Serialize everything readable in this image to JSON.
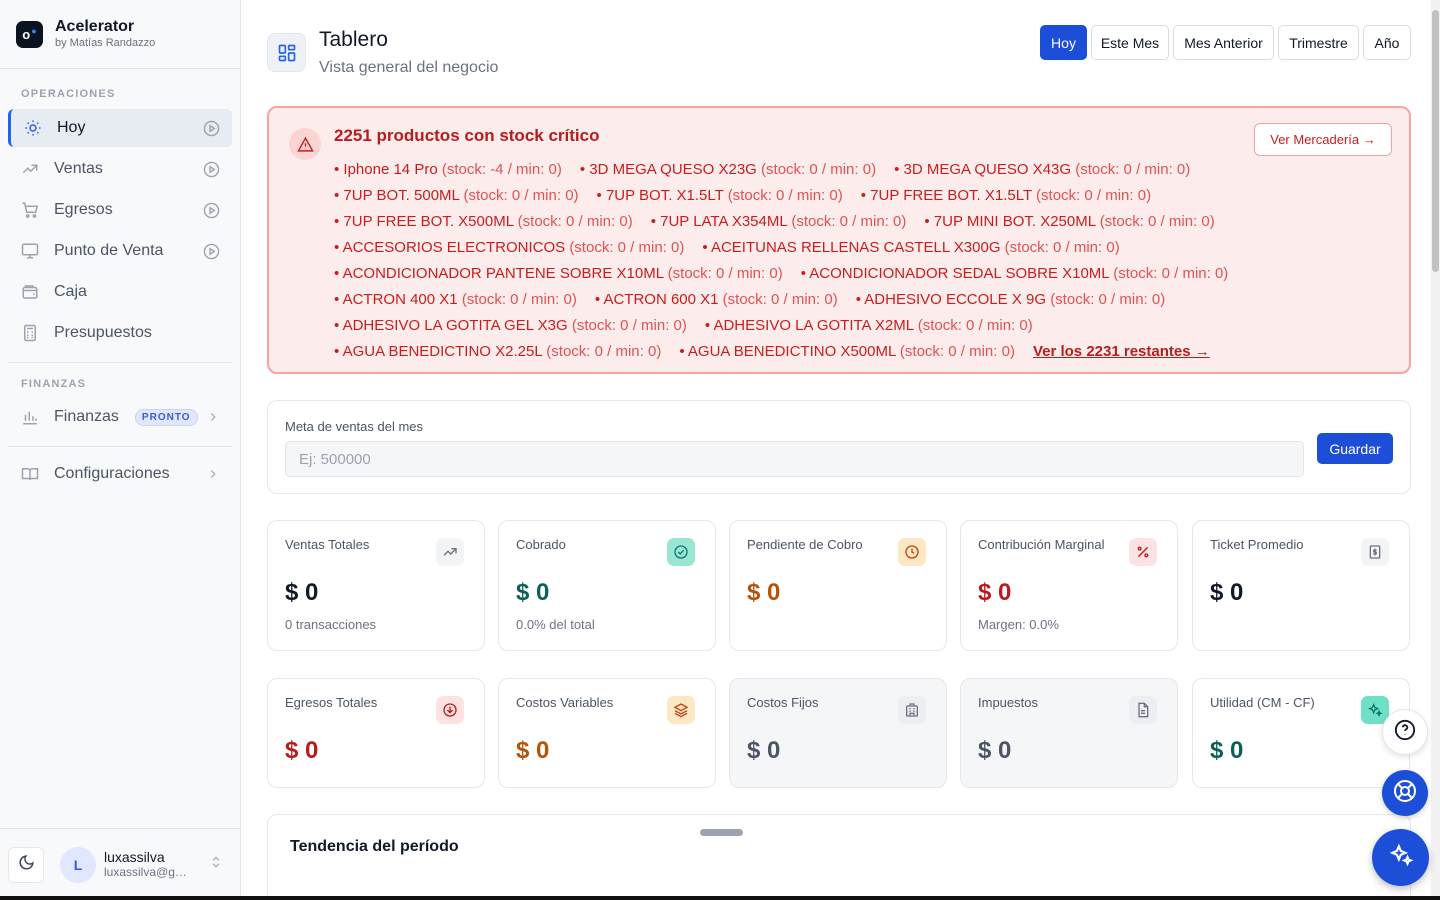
{
  "brand": {
    "name": "Acelerator",
    "sub": "by Matías Randazzo"
  },
  "sidebar": {
    "section_ops": "OPERACIONES",
    "section_fin": "FINANZAS",
    "items": [
      {
        "label": "Hoy"
      },
      {
        "label": "Ventas"
      },
      {
        "label": "Egresos"
      },
      {
        "label": "Punto de Venta"
      },
      {
        "label": "Caja"
      },
      {
        "label": "Presupuestos"
      }
    ],
    "finanzas": {
      "label": "Finanzas",
      "badge": "PRONTO"
    },
    "config": {
      "label": "Configuraciones"
    },
    "user": {
      "initial": "L",
      "name": "luxassilva",
      "email": "luxassilva@gm..."
    }
  },
  "header": {
    "title": "Tablero",
    "subtitle": "Vista general del negocio"
  },
  "periods": [
    "Hoy",
    "Este Mes",
    "Mes Anterior",
    "Trimestre",
    "Año"
  ],
  "alert": {
    "title": "2251 productos con stock crítico",
    "button": "Ver Mercadería →",
    "more": "Ver los 2231 restantes →",
    "lines": [
      [
        {
          "name": "Iphone 14 Pro",
          "info": "(stock: -4 / min: 0)"
        },
        {
          "name": "3D MEGA QUESO X23G",
          "info": "(stock: 0 / min: 0)"
        },
        {
          "name": "3D MEGA QUESO X43G",
          "info": "(stock: 0 / min: 0)"
        }
      ],
      [
        {
          "name": "7UP BOT. 500ML",
          "info": "(stock: 0 / min: 0)"
        },
        {
          "name": "7UP BOT. X1.5LT",
          "info": "(stock: 0 / min: 0)"
        },
        {
          "name": "7UP FREE BOT. X1.5LT",
          "info": "(stock: 0 / min: 0)"
        }
      ],
      [
        {
          "name": "7UP FREE BOT. X500ML",
          "info": "(stock: 0 / min: 0)"
        },
        {
          "name": "7UP LATA X354ML",
          "info": "(stock: 0 / min: 0)"
        },
        {
          "name": "7UP MINI BOT. X250ML",
          "info": "(stock: 0 / min: 0)"
        }
      ],
      [
        {
          "name": "ACCESORIOS ELECTRONICOS",
          "info": "(stock: 0 / min: 0)"
        },
        {
          "name": "ACEITUNAS RELLENAS CASTELL X300G",
          "info": "(stock: 0 / min: 0)"
        }
      ],
      [
        {
          "name": "ACONDICIONADOR PANTENE SOBRE X10ML",
          "info": "(stock: 0 / min: 0)"
        },
        {
          "name": "ACONDICIONADOR SEDAL SOBRE X10ML",
          "info": "(stock: 0 / min: 0)"
        }
      ],
      [
        {
          "name": "ACTRON 400 X1",
          "info": "(stock: 0 / min: 0)"
        },
        {
          "name": "ACTRON 600 X1",
          "info": "(stock: 0 / min: 0)"
        },
        {
          "name": "ADHESIVO ECCOLE X 9G",
          "info": "(stock: 0 / min: 0)"
        }
      ],
      [
        {
          "name": "ADHESIVO LA GOTITA GEL X3G",
          "info": "(stock: 0 / min: 0)"
        },
        {
          "name": "ADHESIVO LA GOTITA X2ML",
          "info": "(stock: 0 / min: 0)"
        }
      ],
      [
        {
          "name": "AGUA BENEDICTINO X2.25L",
          "info": "(stock: 0 / min: 0)"
        },
        {
          "name": "AGUA BENEDICTINO X500ML",
          "info": "(stock: 0 / min: 0)"
        }
      ]
    ]
  },
  "goal": {
    "label": "Meta de ventas del mes",
    "placeholder": "Ej: 500000",
    "button": "Guardar"
  },
  "cards": [
    {
      "label": "Ventas Totales",
      "value": "$ 0",
      "foot": "0 transacciones",
      "icon": "trending-up-icon",
      "color": "#111827",
      "icon_bg": "#f3f4f6",
      "icon_color": "#6b7280"
    },
    {
      "label": "Cobrado",
      "value": "$ 0",
      "foot": "0.0% del total",
      "icon": "check-circle-icon",
      "color": "#0f5f56",
      "icon_bg": "#99e6d4",
      "icon_color": "#0f766e"
    },
    {
      "label": "Pendiente de Cobro",
      "value": "$ 0",
      "foot": "",
      "icon": "clock-icon",
      "color": "#b45309",
      "icon_bg": "#fde7c4",
      "icon_color": "#c2410c"
    },
    {
      "label": "Contribución Marginal",
      "value": "$ 0",
      "foot": "Margen: 0.0%",
      "icon": "percent-icon",
      "color": "#b91c1c",
      "icon_bg": "#fde2e2",
      "icon_color": "#b91c1c"
    },
    {
      "label": "Ticket Promedio",
      "value": "$ 0",
      "foot": "",
      "icon": "receipt-icon",
      "color": "#111827",
      "icon_bg": "#f3f4f6",
      "icon_color": "#6b7280"
    },
    {
      "label": "Egresos Totales",
      "value": "$ 0",
      "foot": "",
      "icon": "arrow-down-circle-icon",
      "color": "#b91c1c",
      "icon_bg": "#fde2e2",
      "icon_color": "#b91c1c"
    },
    {
      "label": "Costos Variables",
      "value": "$ 0",
      "foot": "",
      "icon": "layers-icon",
      "color": "#b45309",
      "icon_bg": "#fde7c4",
      "icon_color": "#c2410c"
    },
    {
      "label": "Costos Fijos",
      "value": "$ 0",
      "foot": "",
      "icon": "building-icon",
      "color": "#4b5563",
      "icon_bg": "#eceef1",
      "icon_color": "#6b7280"
    },
    {
      "label": "Impuestos",
      "value": "$ 0",
      "foot": "",
      "icon": "document-icon",
      "color": "#4b5563",
      "icon_bg": "#eceef1",
      "icon_color": "#6b7280"
    },
    {
      "label": "Utilidad (CM - CF)",
      "value": "$ 0",
      "foot": "",
      "icon": "sparkles-icon",
      "color": "#0f5f56",
      "icon_bg": "#6ee0c6",
      "icon_color": "#0f766e"
    }
  ],
  "trend": {
    "title": "Tendencia del período"
  }
}
